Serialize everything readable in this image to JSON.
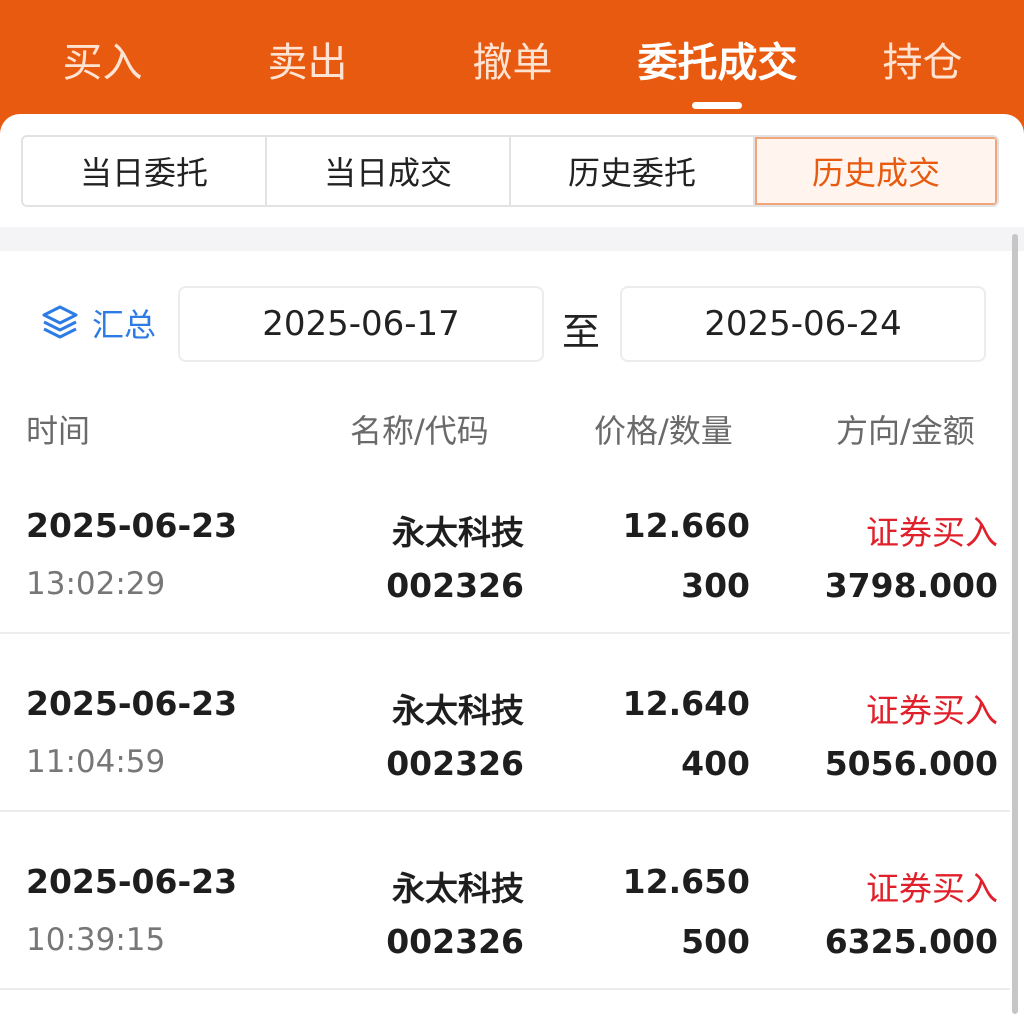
{
  "top_tabs": [
    {
      "label": "买入"
    },
    {
      "label": "卖出"
    },
    {
      "label": "撤单"
    },
    {
      "label": "委托成交"
    },
    {
      "label": "持仓"
    }
  ],
  "sub_tabs": [
    {
      "label": "当日委托"
    },
    {
      "label": "当日成交"
    },
    {
      "label": "历史委托"
    },
    {
      "label": "历史成交"
    }
  ],
  "filter": {
    "summary_label": "汇总",
    "start_date": "2025-06-17",
    "to_label": "至",
    "end_date": "2025-06-24"
  },
  "columns": {
    "time": "时间",
    "name_code": "名称/代码",
    "price_qty": "价格/数量",
    "direction_amount": "方向/金额"
  },
  "rows": [
    {
      "date": "2025-06-23",
      "time": "13:02:29",
      "name": "永太科技",
      "code": "002326",
      "price": "12.660",
      "quantity": "300",
      "direction": "证券买入",
      "amount": "3798.000"
    },
    {
      "date": "2025-06-23",
      "time": "11:04:59",
      "name": "永太科技",
      "code": "002326",
      "price": "12.640",
      "quantity": "400",
      "direction": "证券买入",
      "amount": "5056.000"
    },
    {
      "date": "2025-06-23",
      "time": "10:39:15",
      "name": "永太科技",
      "code": "002326",
      "price": "12.650",
      "quantity": "500",
      "direction": "证券买入",
      "amount": "6325.000"
    }
  ],
  "colors": {
    "brand": "#e85a0f",
    "buy": "#e0202a",
    "link": "#2d7be5"
  },
  "icons": {
    "summary": "layers-icon"
  }
}
